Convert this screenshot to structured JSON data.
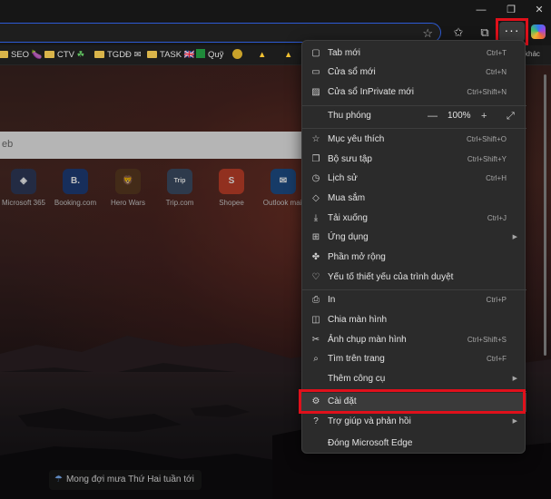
{
  "favorites": [
    {
      "label": "SEO",
      "emoji": "🍆"
    },
    {
      "label": "CTV",
      "emoji": "☘"
    },
    {
      "label": "TGDĐ",
      "emoji": "✉"
    },
    {
      "label": "TASK",
      "emoji": "🇬🇧"
    },
    {
      "label": "Quỹ",
      "emoji": ""
    }
  ],
  "favorites_more": "khác",
  "search_placeholder": "eb",
  "quick_links": [
    {
      "label": "Microsoft 365",
      "glyph": "◈",
      "color": "#2f3a5a"
    },
    {
      "label": "Booking.com",
      "glyph": "B.",
      "color": "#1f3e7a"
    },
    {
      "label": "Hero Wars",
      "glyph": "🦁",
      "color": "#5a3a20"
    },
    {
      "label": "Trip.com",
      "glyph": "Trip",
      "color": "#3e4e66"
    },
    {
      "label": "Shopee",
      "glyph": "S",
      "color": "#c2402a"
    },
    {
      "label": "Outlook mail",
      "glyph": "✉",
      "color": "#1f4f8a"
    }
  ],
  "weather_text": "Mong đợi mưa Thứ Hai tuần tới",
  "menu": {
    "items": [
      {
        "id": "new-tab",
        "icon": "▢",
        "label": "Tab mới",
        "shortcut": "Ctrl+T"
      },
      {
        "id": "new-window",
        "icon": "▭",
        "label": "Cửa sổ mới",
        "shortcut": "Ctrl+N"
      },
      {
        "id": "inprivate",
        "icon": "▨",
        "label": "Cửa sổ InPrivate mới",
        "shortcut": "Ctrl+Shift+N"
      },
      {
        "id": "favorites",
        "icon": "☆",
        "label": "Mục yêu thích",
        "shortcut": "Ctrl+Shift+O"
      },
      {
        "id": "collections",
        "icon": "❐",
        "label": "Bộ sưu tập",
        "shortcut": "Ctrl+Shift+Y"
      },
      {
        "id": "history",
        "icon": "◷",
        "label": "Lịch sử",
        "shortcut": "Ctrl+H"
      },
      {
        "id": "shopping",
        "icon": "◇",
        "label": "Mua sắm",
        "shortcut": ""
      },
      {
        "id": "downloads",
        "icon": "⤓",
        "label": "Tải xuống",
        "shortcut": "Ctrl+J"
      },
      {
        "id": "apps",
        "icon": "⊞",
        "label": "Ứng dụng",
        "shortcut": "",
        "arrow": true
      },
      {
        "id": "extensions",
        "icon": "✤",
        "label": "Phần mở rộng",
        "shortcut": ""
      },
      {
        "id": "essentials",
        "icon": "♡",
        "label": "Yếu tố thiết yếu của trình duyệt",
        "shortcut": ""
      },
      {
        "id": "print",
        "icon": "⎙",
        "label": "In",
        "shortcut": "Ctrl+P"
      },
      {
        "id": "split-screen",
        "icon": "◫",
        "label": "Chia màn hình",
        "shortcut": ""
      },
      {
        "id": "screenshot",
        "icon": "✂",
        "label": "Ảnh chụp màn hình",
        "shortcut": "Ctrl+Shift+S"
      },
      {
        "id": "find",
        "icon": "⌕",
        "label": "Tìm trên trang",
        "shortcut": "Ctrl+F"
      },
      {
        "id": "more-tools",
        "icon": "",
        "label": "Thêm công cụ",
        "shortcut": "",
        "arrow": true
      },
      {
        "id": "settings",
        "icon": "⚙",
        "label": "Cài đặt",
        "shortcut": ""
      },
      {
        "id": "help",
        "icon": "?",
        "label": "Trợ giúp và phản hồi",
        "shortcut": "",
        "arrow": true
      },
      {
        "id": "close-edge",
        "icon": "",
        "label": "Đóng Microsoft Edge",
        "shortcut": ""
      }
    ],
    "zoom": {
      "label": "Thu phóng",
      "value": "100%",
      "minus": "—",
      "plus": "+"
    }
  },
  "colors": {
    "highlight": "#e0101b",
    "accent": "#2d5bd6"
  }
}
